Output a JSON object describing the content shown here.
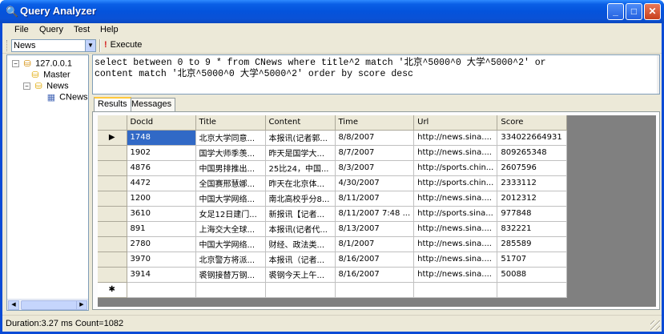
{
  "window": {
    "title": "Query Analyzer",
    "app_icon": "magnifier-icon",
    "controls": {
      "minimize": "_",
      "maximize": "□",
      "close": "✕"
    }
  },
  "menu": [
    "File",
    "Query",
    "Test",
    "Help"
  ],
  "toolbar": {
    "database": "News",
    "execute_label": "Execute",
    "execute_icon": "exclamation-icon"
  },
  "tree": {
    "root": {
      "label": "127.0.0.1",
      "icon": "server-icon"
    },
    "databases": [
      {
        "label": "Master",
        "icon": "database-icon"
      },
      {
        "label": "News",
        "icon": "database-icon",
        "tables": [
          {
            "label": "CNews",
            "icon": "table-icon"
          }
        ]
      }
    ]
  },
  "query": {
    "line1": "select between 0 to 9 * from CNews where title^2 match '北京^5000^0 大学^5000^2' or",
    "line2": "content match '北京^5000^0 大学^5000^2' order by score desc"
  },
  "tabs": [
    "Results",
    "Messages"
  ],
  "grid": {
    "columns": [
      "DocId",
      "Title",
      "Content",
      "Time",
      "Url",
      "Score"
    ],
    "rows": [
      [
        "1748",
        "北京大学同意...",
        "本报讯(记者郭...",
        "8/8/2007",
        "http://news.sina....",
        "334022664931"
      ],
      [
        "1902",
        "国学大师季羡...",
        "昨天是国学大...",
        "8/7/2007",
        "http://news.sina....",
        "809265348"
      ],
      [
        "4876",
        "中国男排推出...",
        "25比24，中国...",
        "8/3/2007",
        "http://sports.chin...",
        "2607596"
      ],
      [
        "4472",
        "全国赛邢慧娜...",
        "昨天在北京体...",
        "4/30/2007",
        "http://sports.chin...",
        "2333112"
      ],
      [
        "1200",
        "中国大学网络...",
        "南北高校乎分8...",
        "8/11/2007",
        "http://news.sina....",
        "2012312"
      ],
      [
        "3610",
        "女足12日建门...",
        "新报讯【记者...",
        "8/11/2007 7:48 ...",
        "http://sports.sina...",
        "977848"
      ],
      [
        "891",
        "上海交大全球...",
        "本报讯(记者代...",
        "8/13/2007",
        "http://news.sina....",
        "832221"
      ],
      [
        "2780",
        "中国大学网络...",
        "财经、政法类...",
        "8/1/2007",
        "http://news.sina....",
        "285589"
      ],
      [
        "3970",
        "北京警方将派...",
        "本报讯（记者...",
        "8/16/2007",
        "http://news.sina....",
        "51707"
      ],
      [
        "3914",
        "裘钢接替万钢...",
        "裘钢今天上午...",
        "8/16/2007",
        "http://news.sina....",
        "50088"
      ]
    ],
    "current_row_marker": "▶",
    "new_row_marker": "✱"
  },
  "status": {
    "text": "Duration:3.27 ms Count=1082"
  }
}
